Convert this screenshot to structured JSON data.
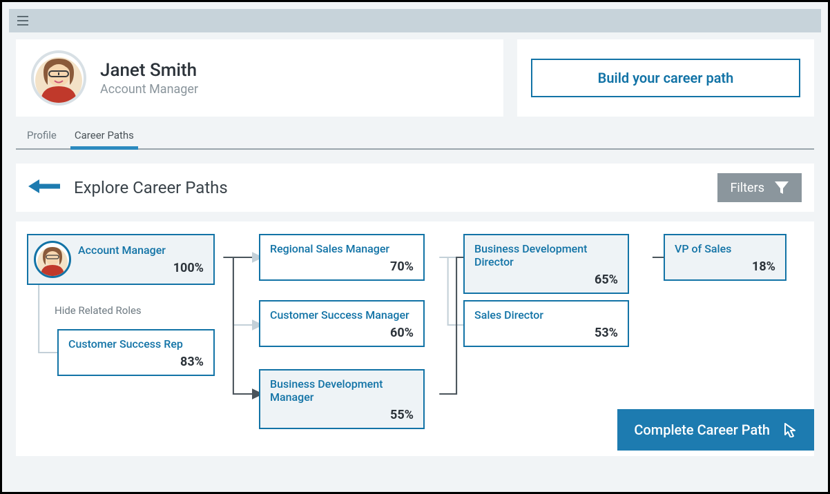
{
  "user": {
    "name": "Janet Smith",
    "title": "Account Manager"
  },
  "cta": {
    "build": "Build your career path"
  },
  "tabs": {
    "profile": "Profile",
    "career_paths": "Career Paths"
  },
  "explore": {
    "title": "Explore Career Paths",
    "filters": "Filters"
  },
  "nodes": {
    "root": {
      "title": "Account Manager",
      "pct": "100%"
    },
    "related": {
      "title": "Customer Success Rep",
      "pct": "83%"
    },
    "l2a": {
      "title": "Regional Sales Manager",
      "pct": "70%"
    },
    "l2b": {
      "title": "Customer Success Manager",
      "pct": "60%"
    },
    "l2c": {
      "title": "Business Development Manager",
      "pct": "55%"
    },
    "l3a": {
      "title": "Business Development Director",
      "pct": "65%"
    },
    "l3b": {
      "title": "Sales Director",
      "pct": "53%"
    },
    "l4": {
      "title": "VP of Sales",
      "pct": "18%"
    }
  },
  "labels": {
    "hide_related": "Hide Related Roles",
    "complete": "Complete Career Path"
  }
}
